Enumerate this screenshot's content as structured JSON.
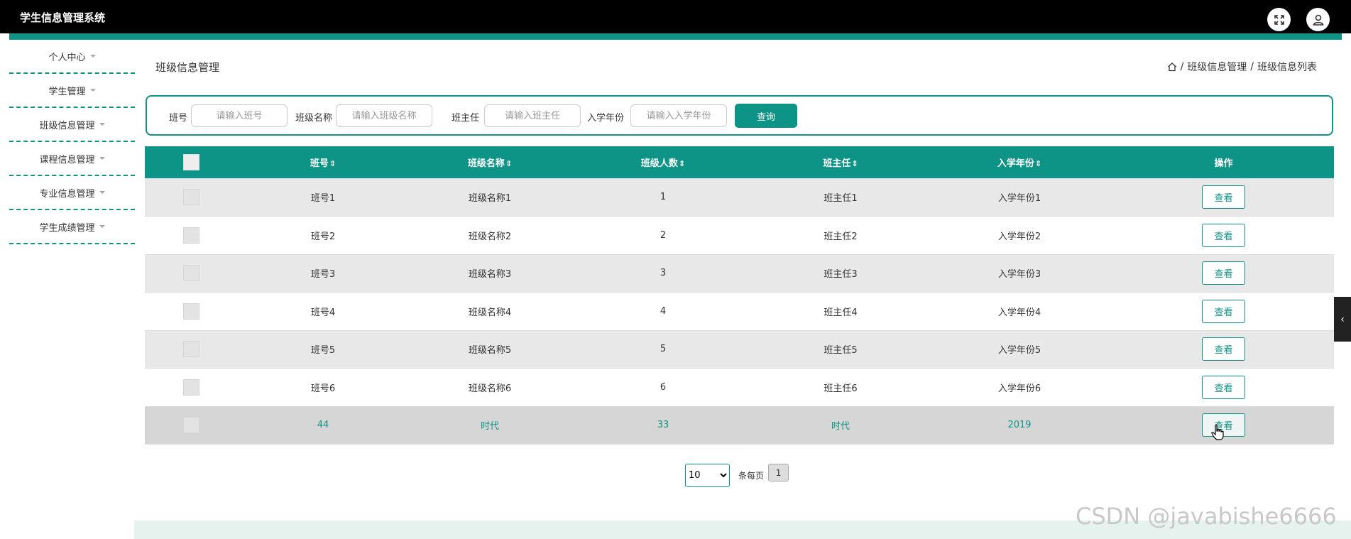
{
  "app": {
    "title": "学生信息管理系统"
  },
  "sidebar": {
    "items": [
      {
        "label": "个人中心"
      },
      {
        "label": "学生管理"
      },
      {
        "label": "班级信息管理"
      },
      {
        "label": "课程信息管理"
      },
      {
        "label": "专业信息管理"
      },
      {
        "label": "学生成绩管理"
      }
    ]
  },
  "page": {
    "title": "班级信息管理"
  },
  "breadcrumb": {
    "sep": "/",
    "items": [
      "班级信息管理",
      "班级信息列表"
    ]
  },
  "search": {
    "fields": [
      {
        "label": "班号",
        "placeholder": "请输入班号"
      },
      {
        "label": "班级名称",
        "placeholder": "请输入班级名称"
      },
      {
        "label": "班主任",
        "placeholder": "请输入班主任"
      },
      {
        "label": "入学年份",
        "placeholder": "请输入入学年份"
      }
    ],
    "button_label": "查询"
  },
  "table": {
    "sort_symbol": "⇕",
    "columns": [
      "班号",
      "班级名称",
      "班级人数",
      "班主任",
      "入学年份",
      "操作"
    ],
    "action_label": "查看",
    "rows": [
      [
        "班号1",
        "班级名称1",
        "1",
        "班主任1",
        "入学年份1"
      ],
      [
        "班号2",
        "班级名称2",
        "2",
        "班主任2",
        "入学年份2"
      ],
      [
        "班号3",
        "班级名称3",
        "3",
        "班主任3",
        "入学年份3"
      ],
      [
        "班号4",
        "班级名称4",
        "4",
        "班主任4",
        "入学年份4"
      ],
      [
        "班号5",
        "班级名称5",
        "5",
        "班主任5",
        "入学年份5"
      ],
      [
        "班号6",
        "班级名称6",
        "6",
        "班主任6",
        "入学年份6"
      ],
      [
        "44",
        "时代",
        "33",
        "时代",
        "2019"
      ]
    ]
  },
  "pagination": {
    "page_size": "10",
    "per_page_label": "条每页",
    "current_page": "1"
  },
  "watermark": "CSDN @javabishe6666",
  "colors": {
    "accent": "#0e9486",
    "topbar": "#000000"
  }
}
